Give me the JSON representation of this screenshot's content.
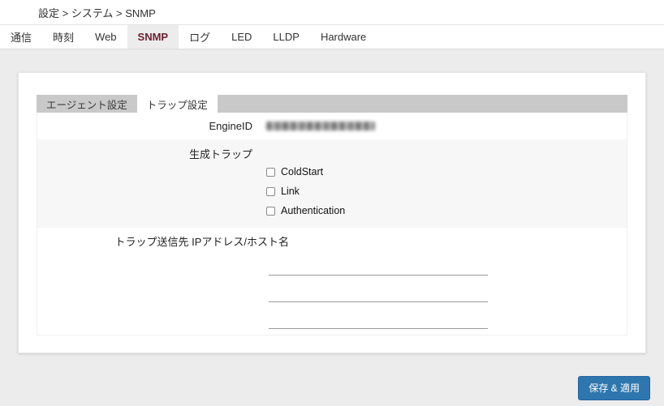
{
  "breadcrumb": {
    "text": "設定 > システム > SNMP"
  },
  "top_tabs": {
    "items": [
      {
        "label": "通信",
        "active": false
      },
      {
        "label": "時刻",
        "active": false
      },
      {
        "label": "Web",
        "active": false
      },
      {
        "label": "SNMP",
        "active": true
      },
      {
        "label": "ログ",
        "active": false
      },
      {
        "label": "LED",
        "active": false
      },
      {
        "label": "LLDP",
        "active": false
      },
      {
        "label": "Hardware",
        "active": false
      }
    ]
  },
  "sub_tabs": {
    "items": [
      {
        "label": "エージェント設定",
        "active": false
      },
      {
        "label": "トラップ設定",
        "active": true
      }
    ]
  },
  "form": {
    "engineid": {
      "label": "EngineID",
      "value_redacted": true
    },
    "traps": {
      "label": "生成トラップ",
      "options": [
        {
          "label": "ColdStart",
          "checked": false
        },
        {
          "label": "Link",
          "checked": false
        },
        {
          "label": "Authentication",
          "checked": false
        }
      ]
    },
    "trap_dest": {
      "label": "トラップ送信先 IPアドレス/ホスト名",
      "inputs": [
        {
          "value": ""
        },
        {
          "value": ""
        },
        {
          "value": ""
        }
      ]
    }
  },
  "actions": {
    "save_label": "保存 & 適用"
  },
  "colors": {
    "accent_maroon": "#6b1f2f",
    "button_blue": "#2e76ad",
    "page_bg": "#ececec",
    "row_alt_bg": "#f7f7f7",
    "subtab_strip_bg": "#c9c9c9"
  }
}
